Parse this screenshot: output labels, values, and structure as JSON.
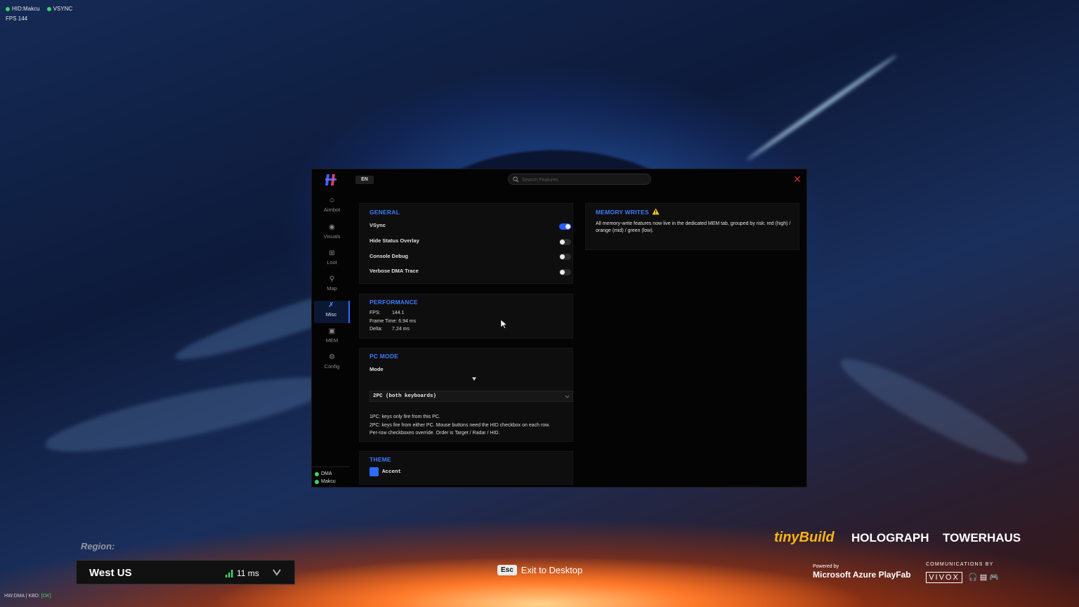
{
  "overlay": {
    "hid_label": "HID:Makcu",
    "vsync_label": "VSYNC",
    "fps_text": "FPS 144",
    "status_color": "#3ed36a"
  },
  "window": {
    "lang": "EN",
    "search_placeholder": "Search Features",
    "close_icon": "close-x-icon"
  },
  "sidebar": {
    "items": [
      {
        "label": "Aimbot",
        "icon": "aimbot-icon",
        "active": false
      },
      {
        "label": "Visuals",
        "icon": "eye-icon",
        "active": false
      },
      {
        "label": "Loot",
        "icon": "loot-box-icon",
        "active": false
      },
      {
        "label": "Map",
        "icon": "map-pin-icon",
        "active": false
      },
      {
        "label": "Misc",
        "icon": "misc-run-icon",
        "active": true
      },
      {
        "label": "MEM",
        "icon": "chip-icon",
        "active": false
      },
      {
        "label": "Config",
        "icon": "gear-icon",
        "active": false
      }
    ],
    "status": [
      {
        "label": "DMA",
        "color": "#3ed36a"
      },
      {
        "label": "Makcu",
        "color": "#3ed36a"
      }
    ]
  },
  "general": {
    "title": "GENERAL",
    "rows": [
      {
        "label": "VSync",
        "on": true
      },
      {
        "label": "Hide Status Overlay",
        "on": false
      },
      {
        "label": "Console Debug",
        "on": false
      },
      {
        "label": "Verbose DMA Trace",
        "on": false
      }
    ]
  },
  "performance": {
    "title": "PERFORMANCE",
    "fps_key": "FPS:",
    "fps_val": "144.1",
    "frame_time": "Frame Time: 6.94 ms",
    "delta_key": "Delta:",
    "delta_val": "7.24 ms"
  },
  "pc_mode": {
    "title": "PC MODE",
    "mode_label": "Mode",
    "selected": "2PC (both keyboards)",
    "help": [
      "1PC: keys only fire from this PC.",
      "2PC: keys fire from either PC. Mouse buttons need the HID checkbox on each row.",
      "Per-row checkboxes override. Order is Target / Radar / HID."
    ]
  },
  "theme": {
    "title": "THEME",
    "accent_label": "Accent",
    "accent_color": "#2a6cff"
  },
  "memory_writes": {
    "title": "MEMORY WRITES",
    "warning_icon": "warning-triangle-icon",
    "text": "All memory-write features now live in the dedicated MEM tab, grouped by risk: red (high) / orange (mid) / green (low)."
  },
  "game": {
    "region_label": "Region:",
    "region_name": "West US",
    "ping": "11 ms",
    "esc_key": "Esc",
    "exit_label": "Exit to Desktop",
    "brand_tinybuild": "tinyBuild",
    "brand_holograph": "HOLOGRAPH",
    "brand_towerhaus": "TOWERHAUS",
    "powered_by": "Powered by",
    "azure": "Microsoft Azure PlayFab",
    "communications_by": "COMMUNICATIONS BY",
    "vivox": "VIVOX",
    "bottom_left_a": "HW:DMA | KBD:",
    "bottom_left_b": "[OK]"
  }
}
